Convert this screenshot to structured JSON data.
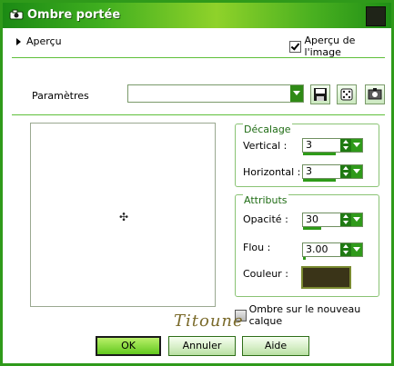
{
  "window": {
    "title": "Ombre portée",
    "title_icon": "camera-icon",
    "close_icon": "close-icon"
  },
  "preview_section": {
    "label": "Aperçu",
    "image_preview_label": "Aperçu de l'image",
    "image_preview_checked": true
  },
  "params": {
    "label": "Paramètres",
    "selected_value": "",
    "tools": [
      "save-preset-icon",
      "random-dice-icon",
      "reset-preset-icon"
    ]
  },
  "offset_group": {
    "title": "Décalage",
    "vertical_label": "Vertical :",
    "vertical_value": "3",
    "horizontal_label": "Horizontal :",
    "horizontal_value": "3"
  },
  "attributes_group": {
    "title": "Attributs",
    "opacity_label": "Opacité :",
    "opacity_value": "30",
    "blur_label": "Flou :",
    "blur_value": "3.00",
    "color_label": "Couleur :",
    "color": "#3a3418"
  },
  "new_layer": {
    "label": "Ombre sur le nouveau calque",
    "checked": false
  },
  "watermark": "Titoune",
  "buttons": {
    "ok": "OK",
    "cancel": "Annuler",
    "help": "Aide"
  },
  "colors": {
    "accent": "#2f9a1a",
    "title_text": "#ffffff"
  }
}
